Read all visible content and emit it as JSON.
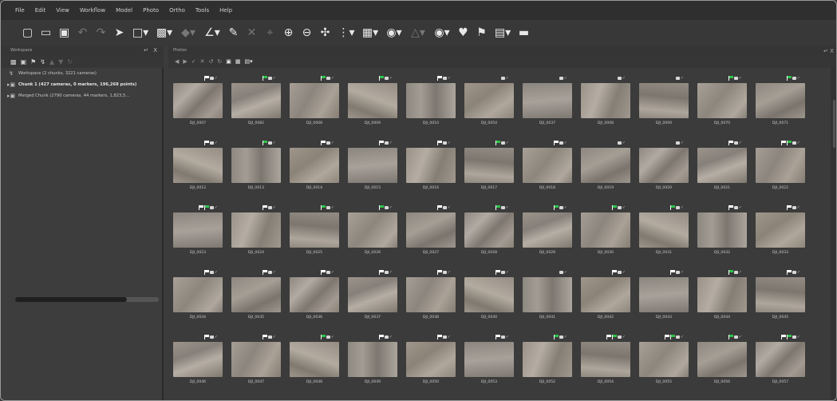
{
  "menu": [
    "File",
    "Edit",
    "View",
    "Workflow",
    "Model",
    "Photo",
    "Ortho",
    "Tools",
    "Help"
  ],
  "workspace": {
    "title": "Workspace",
    "controls": "↵ X",
    "items": [
      {
        "label": "Workspace (2 chunks, 3221 cameras)",
        "icon": "workspace-icon"
      },
      {
        "label": "Chunk 1 (427 cameras, 0 markers, 196,268 points)",
        "icon": "chunk-icon"
      },
      {
        "label": "Merged Chunk (2790 cameras, 44 markers, 1,823,5...",
        "icon": "chunk-icon"
      }
    ],
    "scroll_fraction": 0.78
  },
  "photos": {
    "title": "Photos",
    "side_pin": "↵ X",
    "rows": [
      [
        "DJI_0007",
        "DJI_0082",
        "DJI_0008",
        "DJI_0009",
        "DJI_0010",
        "DJI_0054",
        "DJI_0037",
        "DJI_0008",
        "DJI_0009",
        "DJI_0070",
        "DJI_0071"
      ],
      [
        "DJI_0012",
        "DJI_0013",
        "DJI_0014",
        "DJI_0015",
        "DJI_0016",
        "DJI_0017",
        "DJI_0018",
        "DJI_0019",
        "DJI_0020",
        "DJI_0021",
        "DJI_0022"
      ],
      [
        "DJI_0023",
        "DJI_0024",
        "DJI_0025",
        "DJI_0026",
        "DJI_0027",
        "DJI_0028",
        "DJI_0029",
        "DJI_0030",
        "DJI_0031",
        "DJI_0032",
        "DJI_0033"
      ],
      [
        "DJI_0034",
        "DJI_0035",
        "DJI_0036",
        "DJI_0037",
        "DJI_0038",
        "DJI_0040",
        "DJI_0041",
        "DJI_0042",
        "DJI_0043",
        "DJI_0044",
        "DJI_0045"
      ],
      [
        "DJI_0046",
        "DJI_0047",
        "DJI_0048",
        "DJI_0049",
        "DJI_0050",
        "DJI_0053",
        "DJI_0052",
        "DJI_0054",
        "DJI_0055",
        "DJI_0056",
        "DJI_0057"
      ]
    ],
    "flags": [
      [
        "white",
        "green",
        "green",
        "green",
        "white",
        "none",
        "none",
        "none",
        "none",
        "green",
        "green"
      ],
      [
        "white",
        "green",
        "white",
        "white",
        "white",
        "green",
        "white",
        "none",
        "none",
        "white",
        "whitegreen"
      ],
      [
        "whitegreen",
        "white",
        "green",
        "green",
        "white",
        "green",
        "green",
        "green",
        "green",
        "white",
        "white"
      ],
      [
        "white",
        "white",
        "white",
        "white",
        "white",
        "white",
        "none",
        "white",
        "white",
        "green",
        "white"
      ],
      [
        "white",
        "white",
        "green",
        "white",
        "white",
        "white",
        "green",
        "whitegreen",
        "whitegreen",
        "green",
        "whitegreen"
      ]
    ]
  },
  "colors": {
    "background": "#3b3b3b",
    "accent_flag": "#2ec24b"
  }
}
